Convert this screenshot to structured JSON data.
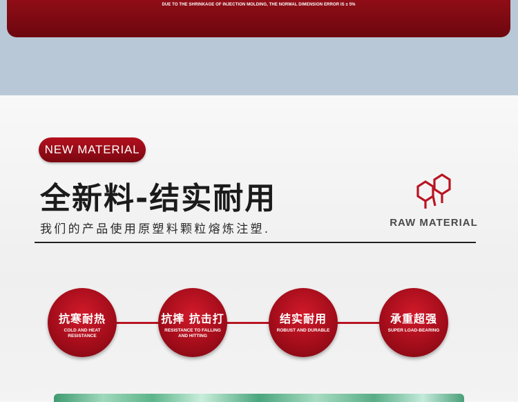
{
  "top_note": "DUE TO THE SHRINKAGE OF INJECTION MOLDING, THE NORMAL DIMENSION ERROR IS ± 5%",
  "badge": "NEW MATERIAL",
  "headline": "全新料-结实耐用",
  "subline": "我们的产品使用原塑料颗粒熔炼注塑.",
  "raw": {
    "icon": "hexagon-molecule-icon",
    "label": "RAW MATERIAL"
  },
  "colors": {
    "accent": "#a50d1b",
    "top_band": "#b8c8d6",
    "dark_red": "#6d0710"
  },
  "features": [
    {
      "cn": "抗寒耐热",
      "en": "COLD AND HEAT RESISTANCE"
    },
    {
      "cn": "抗摔 抗击打",
      "en": "RESISTANCE TO FALLING AND HITTING"
    },
    {
      "cn": "结实耐用",
      "en": "ROBUST AND DURABLE"
    },
    {
      "cn": "承重超强",
      "en": "SUPER LOAD-BEARING"
    }
  ]
}
